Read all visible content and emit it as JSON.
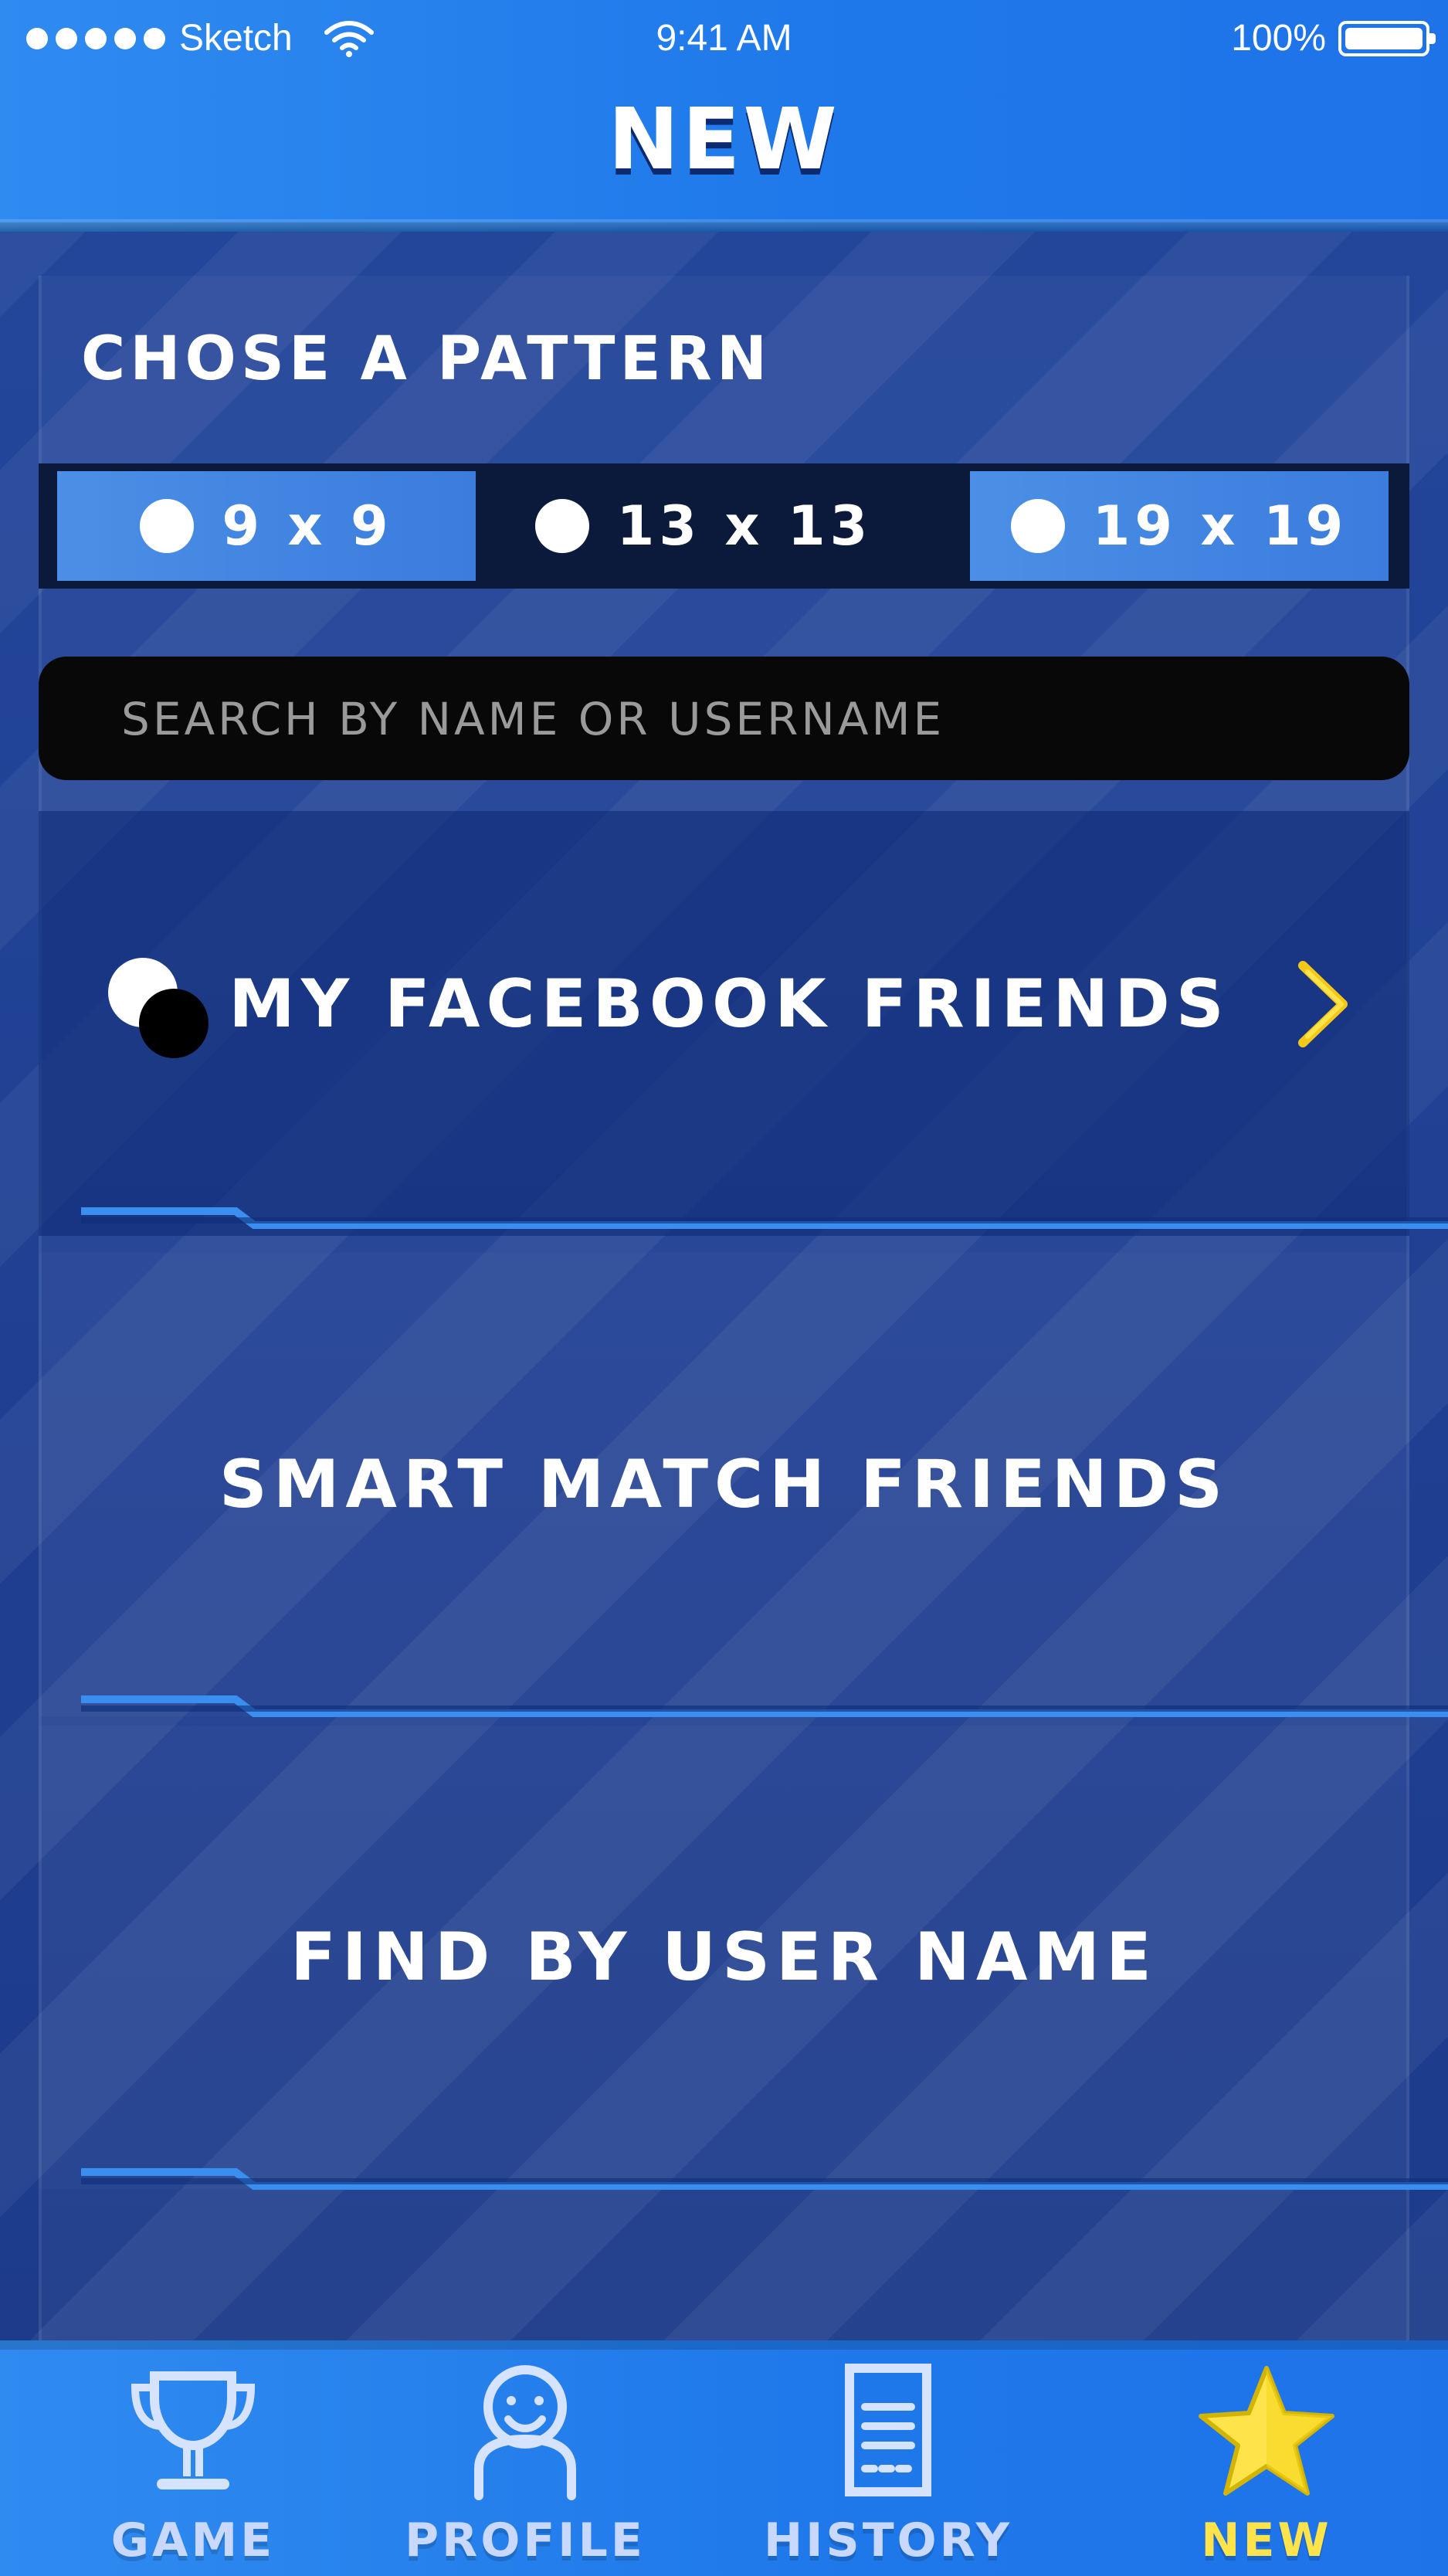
{
  "status_bar": {
    "carrier": "Sketch",
    "time": "9:41 AM",
    "battery": "100%"
  },
  "header": {
    "title": "NEW"
  },
  "pattern": {
    "title": "CHOSE A PATTERN",
    "options": [
      {
        "label": "9 x 9"
      },
      {
        "label": "13 x 13"
      },
      {
        "label": "19 x 19"
      }
    ]
  },
  "search": {
    "placeholder": "SEARCH BY NAME OR USERNAME"
  },
  "menu": {
    "items": [
      {
        "label": "MY FACEBOOK FRIENDS"
      },
      {
        "label": "SMART MATCH FRIENDS"
      },
      {
        "label": "FIND BY USER NAME"
      }
    ]
  },
  "bottom_nav": {
    "items": [
      {
        "label": "GAME"
      },
      {
        "label": "PROFILE"
      },
      {
        "label": "HISTORY"
      },
      {
        "label": "NEW"
      }
    ]
  },
  "colors": {
    "primary_blue": "#1f79ea",
    "panel_blue": "#1f3f92",
    "accent_yellow": "#ffe34a",
    "search_black": "#080808"
  }
}
